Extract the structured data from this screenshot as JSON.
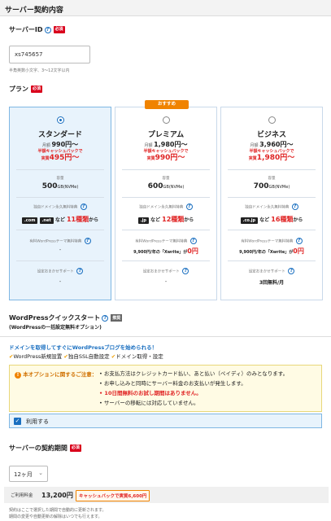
{
  "section_title": "サーバー契約内容",
  "server_id": {
    "label": "サーバーID",
    "required": "必須",
    "value": "xs745657",
    "hint": "半角英数小文字、3〜12文字以内"
  },
  "plan": {
    "label": "プラン",
    "required": "必須",
    "cards": [
      {
        "name": "スタンダード",
        "selected": true,
        "badge": "",
        "monthly_prefix": "月額",
        "monthly_price": "990円〜",
        "cashback_line1": "半額キャッシュバックで",
        "cashback_prefix": "実質",
        "cashback_price": "495円〜",
        "storage_label": "容量",
        "storage_value": "500",
        "storage_unit": "GB(NVMe)",
        "domain_label": "独自ドメイン永久無料特典",
        "domain_text_1": ".com",
        "domain_text_2": ".net",
        "domain_text_3": "など",
        "domain_count": "11種類",
        "domain_text_4": "から",
        "wp_label": "有料WordPressテーマ無料特典",
        "wp_value": "-",
        "support_label": "設定おまかせサポート",
        "support_value": "-"
      },
      {
        "name": "プレミアム",
        "selected": false,
        "badge": "おすすめ",
        "monthly_prefix": "月額",
        "monthly_price": "1,980円〜",
        "cashback_line1": "半額キャッシュバックで",
        "cashback_prefix": "実質",
        "cashback_price": "990円〜",
        "storage_label": "容量",
        "storage_value": "600",
        "storage_unit": "GB(NVMe)",
        "domain_label": "独自ドメイン永久無料特典",
        "domain_text_1": ".jp",
        "domain_text_2": "",
        "domain_text_3": "など",
        "domain_count": "12種類",
        "domain_text_4": "から",
        "wp_label": "有料WordPressテーマ無料特典",
        "wp_value_prefix": "9,900円/年の「Xwrite」が",
        "wp_value_free": "0円",
        "support_label": "設定おまかせサポート",
        "support_value": "-"
      },
      {
        "name": "ビジネス",
        "selected": false,
        "badge": "",
        "monthly_prefix": "月額",
        "monthly_price": "3,960円〜",
        "cashback_line1": "半額キャッシュバックで",
        "cashback_prefix": "実質",
        "cashback_price": "1,980円〜",
        "storage_label": "容量",
        "storage_value": "700",
        "storage_unit": "GB(NVMe)",
        "domain_label": "独自ドメイン永久無料特典",
        "domain_text_1": ".co.jp",
        "domain_text_2": "",
        "domain_text_3": "など",
        "domain_count": "16種類",
        "domain_text_4": "から",
        "wp_label": "有料WordPressテーマ無料特典",
        "wp_value_prefix": "9,900円/年の「Xwrite」が",
        "wp_value_free": "0円",
        "support_label": "設定おまかせサポート",
        "support_value": "3回無料/月"
      }
    ]
  },
  "wp_quick": {
    "title": "WordPressクイックスタート",
    "tag": "推奨",
    "subtitle": "(WordPressの一括設定無料オプション)",
    "promo": "ドメインを取得してすぐにWordPressブログを始められる！",
    "features": [
      "WordPress新規設置",
      "独自SSL自動設定",
      "ドメイン取得・設定"
    ],
    "notice_title": "本オプションに関するご注意：",
    "notices": [
      "お支払方法はクレジットカード払い、あと払い（ペイディ）のみとなります。",
      "お申し込みと同時にサーバー料金のお支払いが発生します。",
      "10日間無料のお試し期間はありません。",
      "サーバーの移転には対応していません。"
    ],
    "checkbox_label": "利用する"
  },
  "term": {
    "label": "サーバーの契約期間",
    "required": "必須",
    "selected": "12ヶ月",
    "fee_label": "ご利用料金",
    "fee_value": "13,200円",
    "cashback": "キャッシュバックで実質6,600円",
    "note1": "契約はここで選択した期間で自動的に更新されます。",
    "note2": "期間の変更や自動更新の解除はいつでも行えます。"
  },
  "colors": {
    "accent": "#1a6fc0",
    "red": "#e02424",
    "orange": "#f08300",
    "selected_bg": "#e8f3fc"
  }
}
